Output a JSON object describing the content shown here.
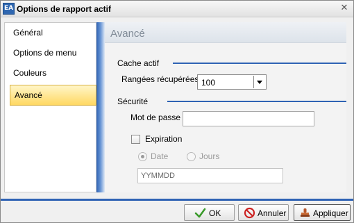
{
  "window": {
    "title": "Options de rapport actif",
    "app_icon_letters": "EA",
    "close_glyph": "✕"
  },
  "nav": {
    "items": [
      {
        "label": "Général",
        "active": false
      },
      {
        "label": "Options de menu",
        "active": false
      },
      {
        "label": "Couleurs",
        "active": false
      },
      {
        "label": "Avancé",
        "active": true
      }
    ]
  },
  "panel": {
    "title": "Avancé",
    "cache_section": "Cache actif",
    "rows_label": "Rangées récupérées",
    "rows_value": "100",
    "security_section": "Sécurité",
    "password_label": "Mot de passe",
    "password_value": "",
    "expiration_label": "Expiration",
    "expiration_checked": false,
    "radio_date_label": "Date",
    "radio_days_label": "Jours",
    "date_format_value": "YYMMDD"
  },
  "footer": {
    "ok_label": "OK",
    "cancel_label": "Annuler",
    "apply_label": "Appliquer"
  },
  "colors": {
    "accent_blue": "#2e62b4",
    "active_nav_yellow": "#ffd862",
    "ok_green": "#3a9a2a",
    "cancel_red": "#cc2222"
  },
  "icons": {
    "app": "app-logo-icon",
    "close": "close-icon",
    "ok": "checkmark-icon",
    "cancel": "no-entry-icon",
    "apply": "stamp-icon",
    "dropdown": "chevron-down-icon"
  }
}
